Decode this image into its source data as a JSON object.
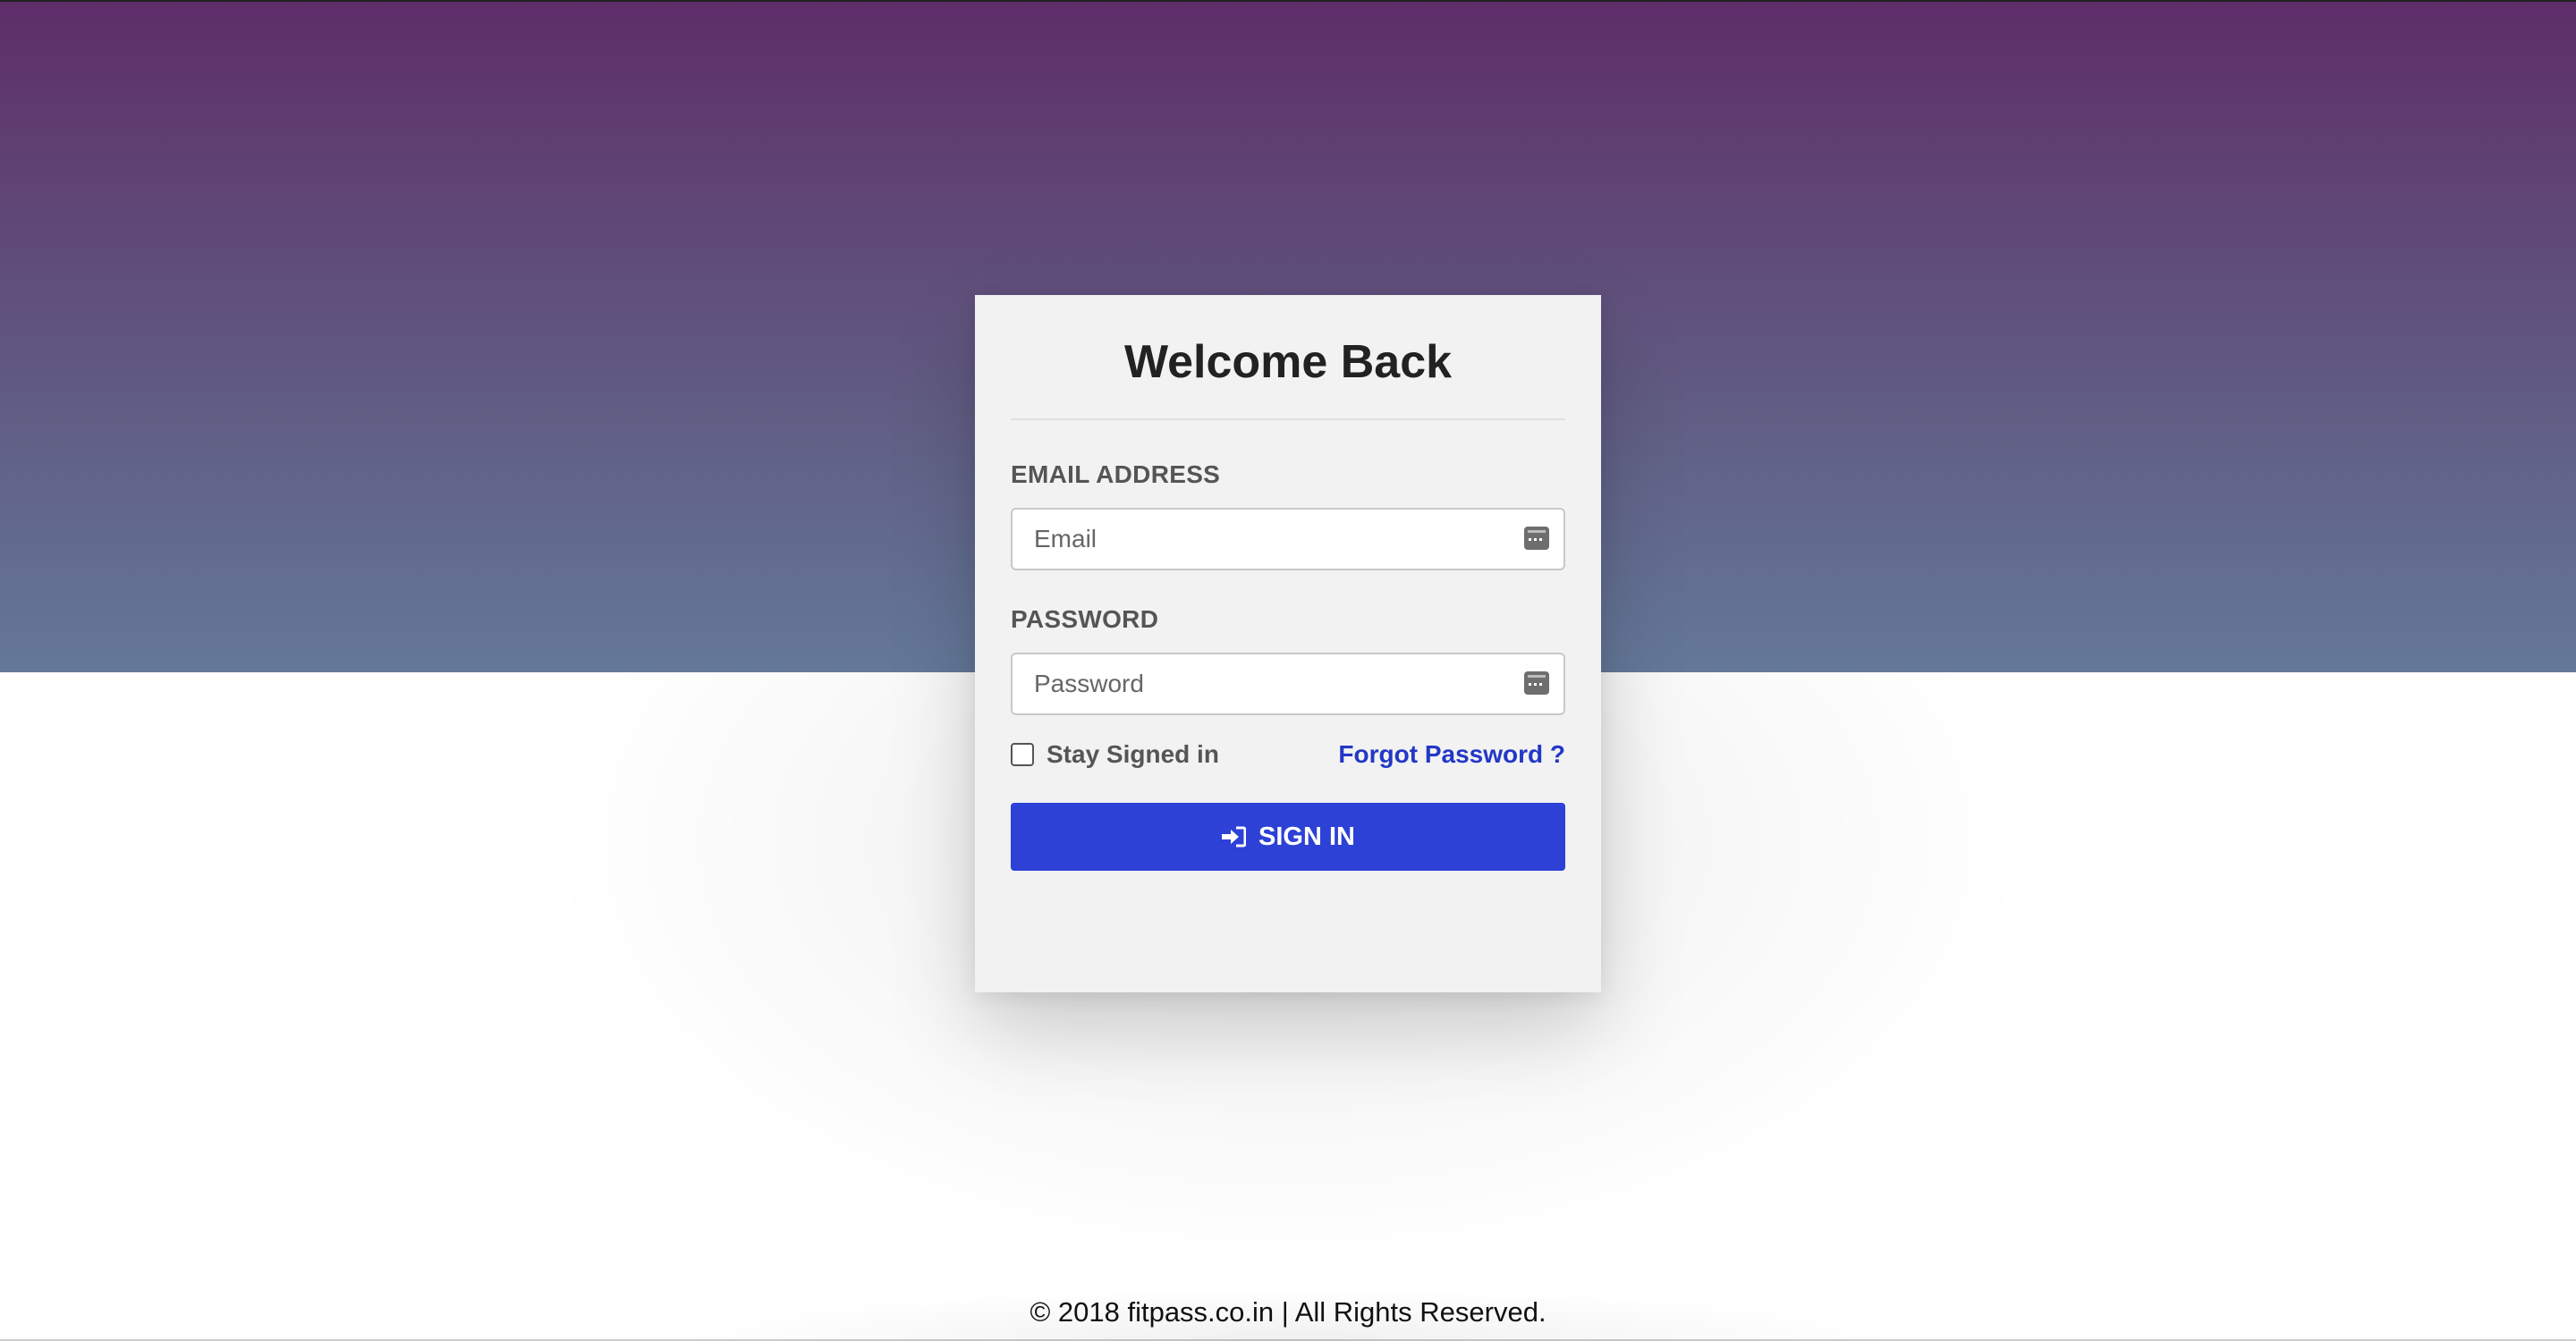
{
  "login": {
    "title": "Welcome Back",
    "email_label": "EMAIL ADDRESS",
    "email_value": "",
    "email_placeholder": "Email",
    "password_label": "PASSWORD",
    "password_value": "",
    "password_placeholder": "Password",
    "remember_label": "Stay Signed in",
    "remember_checked": false,
    "forgot_label": "Forgot Password ?",
    "signin_label": "SIGN IN",
    "signin_icon": "sign-in-icon",
    "field_icon": "password-manager-keys-icon"
  },
  "footer": {
    "copyright": "© 2018 fitpass.co.in | All Rights Reserved."
  },
  "colors": {
    "header_top": "#5e2d69",
    "header_bottom": "#647899",
    "primary_button": "#2d41d6",
    "link": "#2337c6",
    "card_background": "#f2f2f2"
  }
}
